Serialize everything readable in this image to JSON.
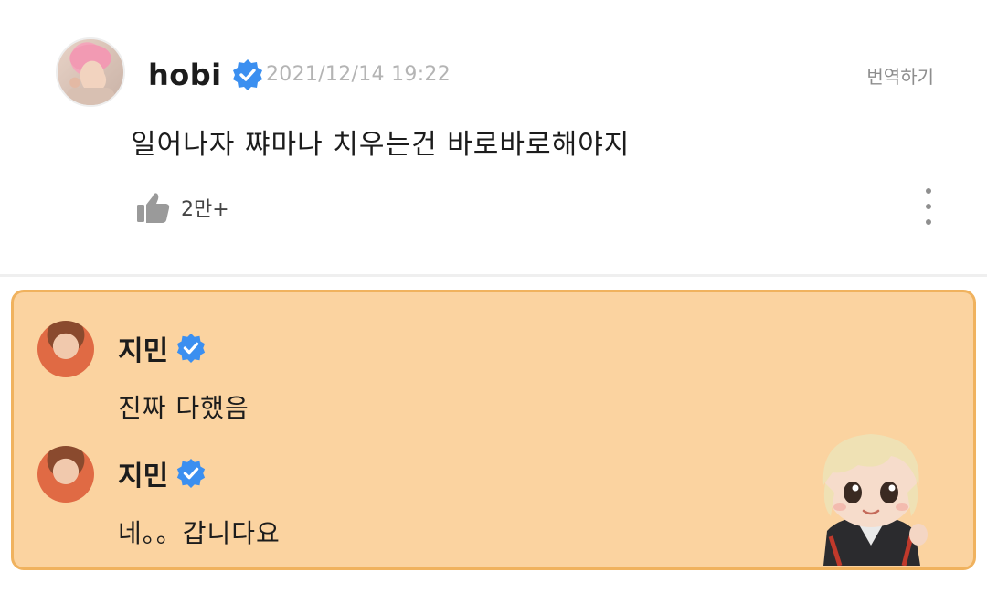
{
  "post": {
    "author": "hobi",
    "timestamp": "2021/12/14 19:22",
    "translate_label": "번역하기",
    "text": "일어나자 쨔마나 치우는건 바로바로해야지",
    "likes": "2만+"
  },
  "replies": [
    {
      "author": "지민",
      "text": "진짜 다했음"
    },
    {
      "author": "지민",
      "text": "네。。갑니다요"
    }
  ],
  "icons": {
    "verified": "verified-check-icon",
    "like": "thumbs-up-icon",
    "more": "more-vertical-icon"
  },
  "colors": {
    "reply_background": "#fbd3a0",
    "reply_border": "#f0b25e",
    "verified_blue": "#3b8ff0",
    "timestamp_gray": "#b4b4b4"
  }
}
